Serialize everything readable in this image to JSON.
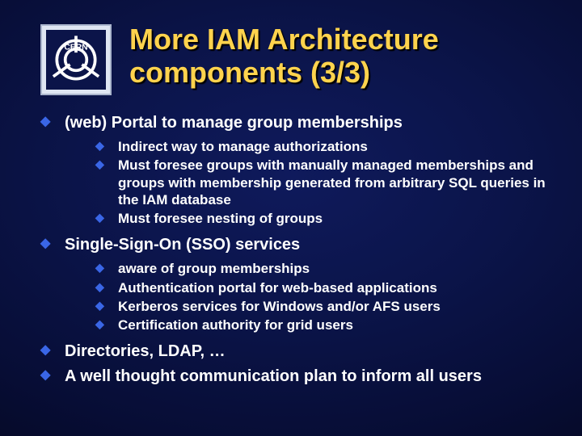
{
  "logo_text": "CERN",
  "title_line1": "More IAM Architecture",
  "title_line2": "components (3/3)",
  "items": [
    {
      "text": "(web) Portal to manage group memberships",
      "sub": [
        "Indirect way to manage authorizations",
        "Must foresee groups with manually managed memberships and groups with membership generated from arbitrary SQL queries in the IAM database",
        "Must foresee nesting of groups"
      ]
    },
    {
      "text": "Single-Sign-On (SSO) services",
      "sub": [
        "aware of group memberships",
        "Authentication portal for web-based applications",
        "Kerberos services for Windows and/or AFS users",
        "Certification authority for grid users"
      ]
    },
    {
      "text": "Directories, LDAP, …",
      "sub": []
    },
    {
      "text": "A well thought communication plan to inform all users",
      "sub": []
    }
  ]
}
